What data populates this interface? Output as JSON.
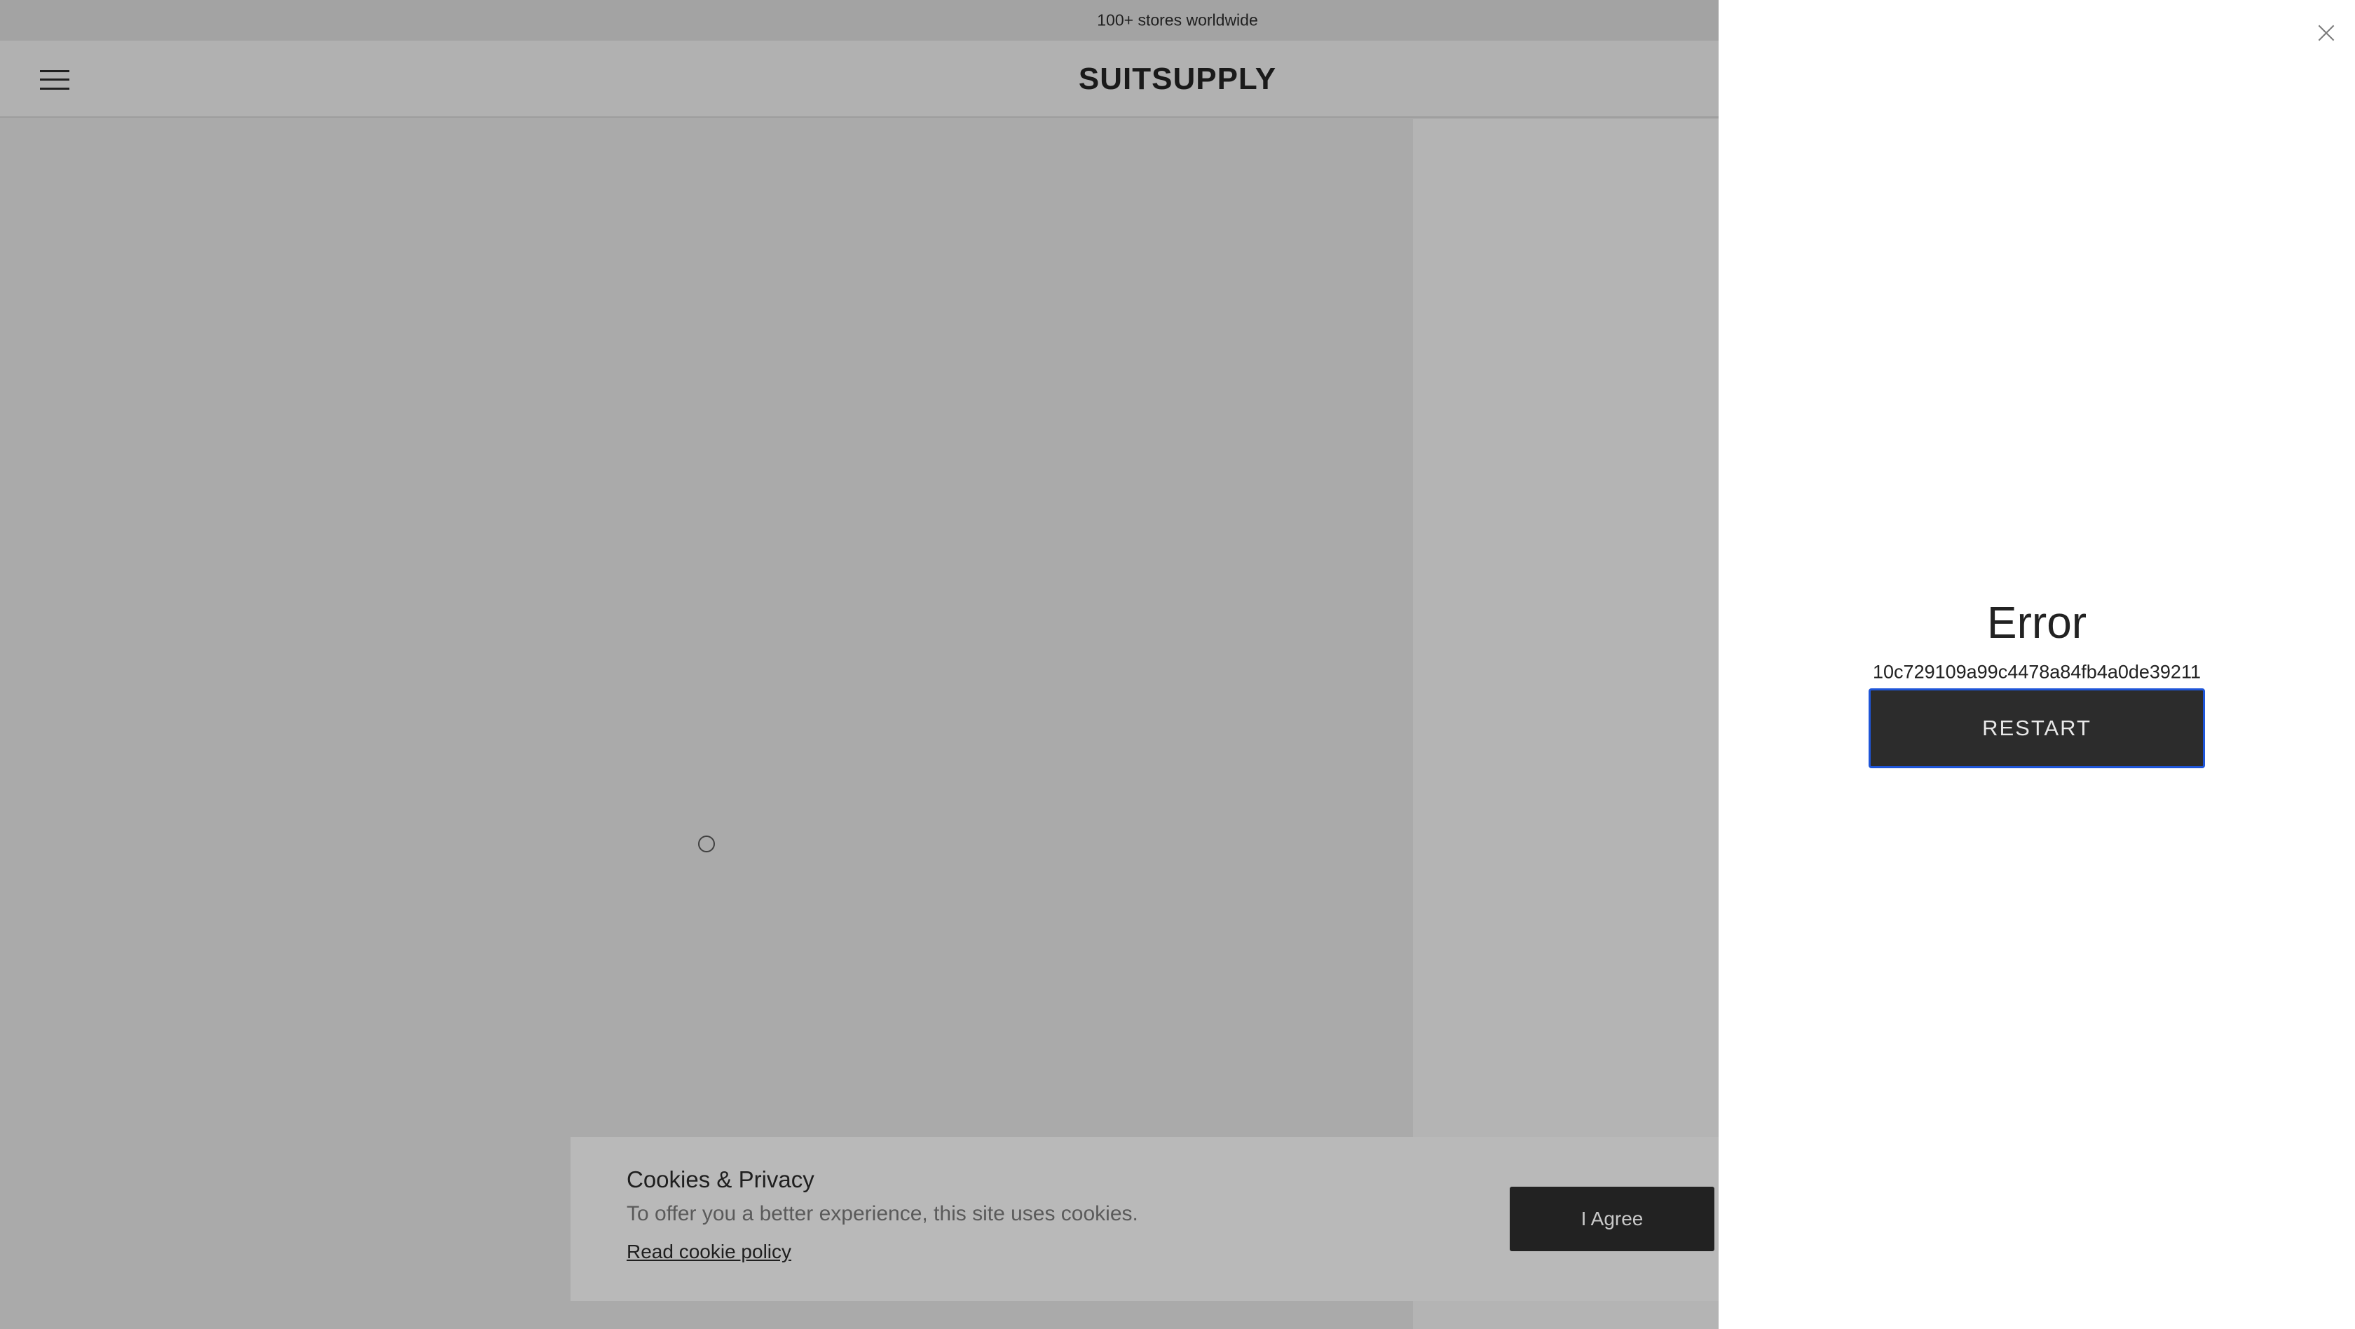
{
  "announcement": {
    "text": "100+ stores worldwide"
  },
  "header": {
    "logo": "SUITSUPPLY",
    "menu_icon": "hamburger-menu-icon"
  },
  "main": {
    "loader_icon": "loading-spinner-icon"
  },
  "cookie_banner": {
    "title": "Cookies & Privacy",
    "text": "To offer you a better experience, this site uses cookies.",
    "link_label": "Read cookie policy",
    "agree_label": "I Agree"
  },
  "error_panel": {
    "title": "Error",
    "code": "10c729109a99c4478a84fb4a0de39211",
    "restart_label": "RESTART",
    "close_icon": "close-icon",
    "accent_color": "#1e55d8"
  }
}
